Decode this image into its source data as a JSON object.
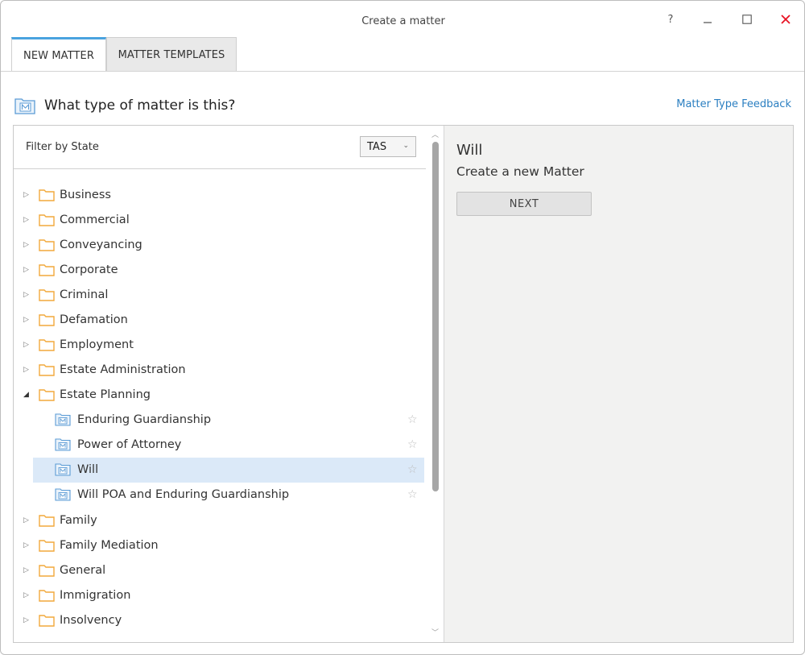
{
  "window": {
    "title": "Create a matter",
    "help_label": "?",
    "close_label": "✕"
  },
  "tabs": [
    {
      "label": "NEW MATTER",
      "active": true
    },
    {
      "label": "MATTER TEMPLATES",
      "active": false
    }
  ],
  "heading": {
    "text": "What type of matter is this?",
    "feedback_link": "Matter Type Feedback"
  },
  "filter": {
    "label": "Filter by State",
    "selected_state": "TAS"
  },
  "tree": [
    {
      "label": "Business",
      "expanded": false
    },
    {
      "label": "Commercial",
      "expanded": false
    },
    {
      "label": "Conveyancing",
      "expanded": false
    },
    {
      "label": "Corporate",
      "expanded": false
    },
    {
      "label": "Criminal",
      "expanded": false
    },
    {
      "label": "Defamation",
      "expanded": false
    },
    {
      "label": "Employment",
      "expanded": false
    },
    {
      "label": "Estate Administration",
      "expanded": false
    },
    {
      "label": "Estate Planning",
      "expanded": true
    },
    {
      "label": "Family",
      "expanded": false
    },
    {
      "label": "Family Mediation",
      "expanded": false
    },
    {
      "label": "General",
      "expanded": false
    },
    {
      "label": "Immigration",
      "expanded": false
    },
    {
      "label": "Insolvency",
      "expanded": false
    }
  ],
  "estate_planning_children": [
    {
      "label": "Enduring Guardianship",
      "selected": false
    },
    {
      "label": "Power of Attorney",
      "selected": false
    },
    {
      "label": "Will",
      "selected": true
    },
    {
      "label": "Will POA and Enduring Guardianship",
      "selected": false
    }
  ],
  "detail": {
    "title": "Will",
    "subtitle": "Create a new Matter",
    "next_label": "NEXT"
  },
  "colors": {
    "accent": "#4aa3df",
    "link": "#2b7fc1",
    "close": "#e81123",
    "folder": "#f2a93b",
    "matter_icon": "#5b9bd5",
    "selection": "#dbe9f8"
  }
}
